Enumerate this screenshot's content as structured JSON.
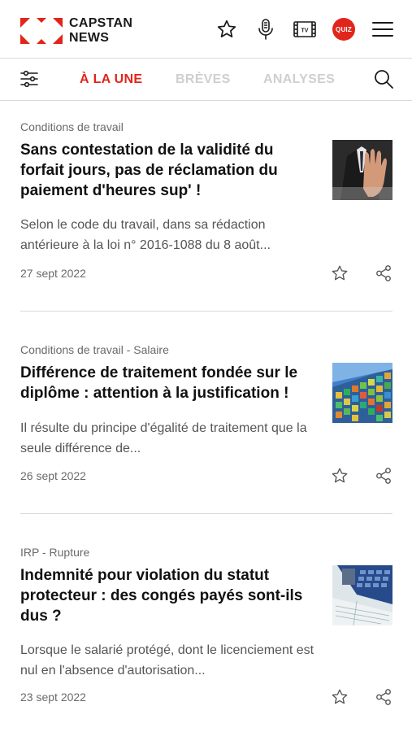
{
  "header": {
    "logo_line1": "CAPSTAN",
    "logo_line2": "NEWS",
    "quiz_label": "QUIZ",
    "brand_color": "#e1251b",
    "icons": [
      "star-icon",
      "microphone-icon",
      "tv-icon",
      "quiz-icon",
      "menu-icon"
    ]
  },
  "tabs": {
    "items": [
      {
        "label": "À LA UNE",
        "active": true
      },
      {
        "label": "BRÈVES",
        "active": false
      },
      {
        "label": "ANALYSES",
        "active": false
      }
    ]
  },
  "articles": [
    {
      "category": "Conditions de travail",
      "title": "Sans contestation de la validité du forfait jours, pas de réclamation du paiement d'heures sup' !",
      "excerpt": "Selon le code du travail, dans sa rédaction antérieure à la loi n° 2016-1088 du 8 août...",
      "date": "27 sept 2022"
    },
    {
      "category": "Conditions de travail - Salaire",
      "title": "Différence de traitement fondée sur le diplôme : attention à la justification !",
      "excerpt": "Il résulte du principe d'égalité de traitement que la seule différence de...",
      "date": "26 sept 2022"
    },
    {
      "category": "IRP - Rupture",
      "title": "Indemnité pour violation du statut protecteur : des congés payés sont-ils dus ?",
      "excerpt": "Lorsque le salarié protégé, dont le licenciement est nul en l'absence d'autorisation...",
      "date": "23 sept 2022"
    }
  ]
}
